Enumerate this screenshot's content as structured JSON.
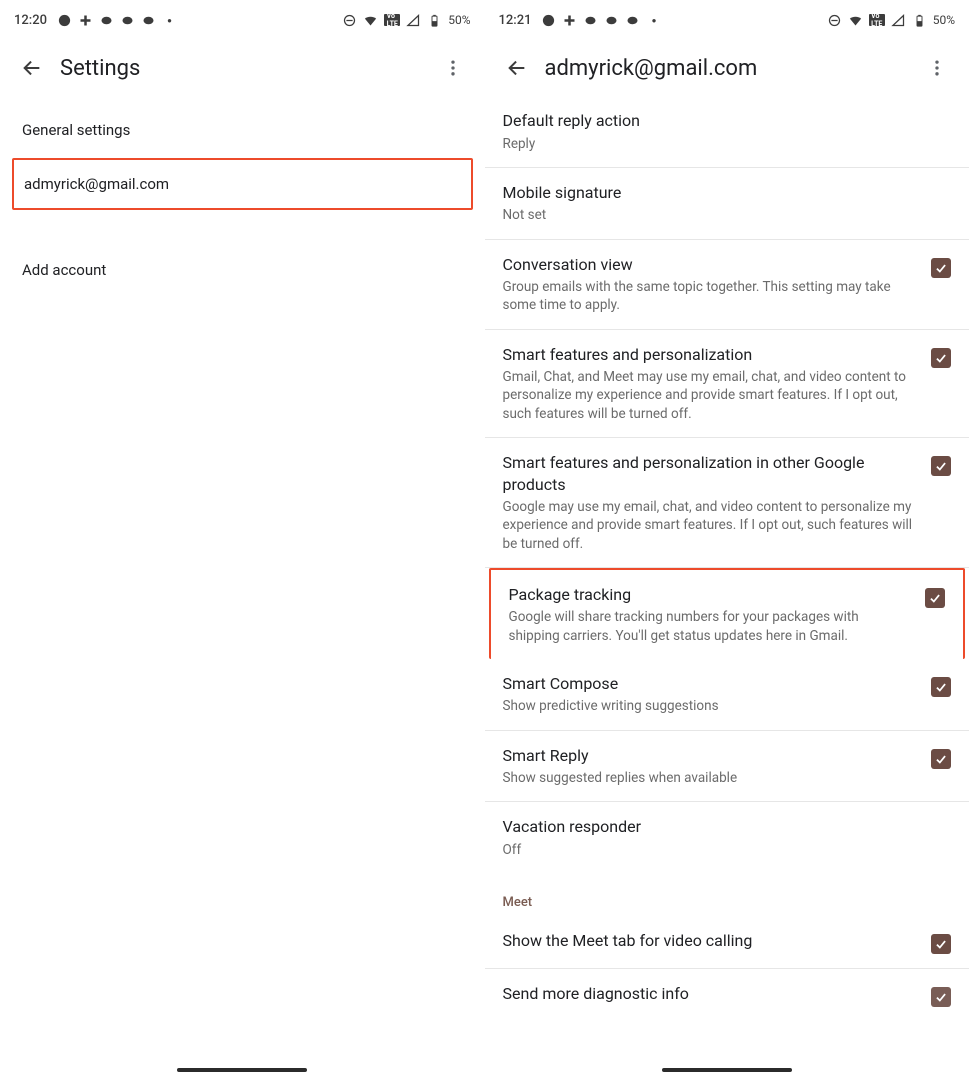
{
  "left": {
    "status": {
      "time": "12:20",
      "battery": "50%"
    },
    "title": "Settings",
    "items": {
      "general": "General settings",
      "account": "admyrick@gmail.com",
      "add": "Add account"
    }
  },
  "right": {
    "status": {
      "time": "12:21",
      "battery": "50%"
    },
    "title": "admyrick@gmail.com",
    "rows": {
      "defaultReply": {
        "title": "Default reply action",
        "sub": "Reply"
      },
      "signature": {
        "title": "Mobile signature",
        "sub": "Not set"
      },
      "conversation": {
        "title": "Conversation view",
        "sub": "Group emails with the same topic together. This setting may take some time to apply."
      },
      "smartFeat": {
        "title": "Smart features and personalization",
        "sub": "Gmail, Chat, and Meet may use my email, chat, and video content to personalize my experience and provide smart features. If I opt out, such features will be turned off."
      },
      "smartFeatOther": {
        "title": "Smart features and personalization in other Google products",
        "sub": "Google may use my email, chat, and video content to personalize my experience and provide smart features. If I opt out, such features will be turned off."
      },
      "packageTracking": {
        "title": "Package tracking",
        "sub": "Google will share tracking numbers for your packages with shipping carriers. You'll get status updates here in Gmail."
      },
      "smartCompose": {
        "title": "Smart Compose",
        "sub": "Show predictive writing suggestions"
      },
      "smartReply": {
        "title": "Smart Reply",
        "sub": "Show suggested replies when available"
      },
      "vacation": {
        "title": "Vacation responder",
        "sub": "Off"
      },
      "meetHeader": "Meet",
      "meetTab": {
        "title": "Show the Meet tab for video calling"
      },
      "diag": {
        "title": "Send more diagnostic info"
      }
    }
  }
}
